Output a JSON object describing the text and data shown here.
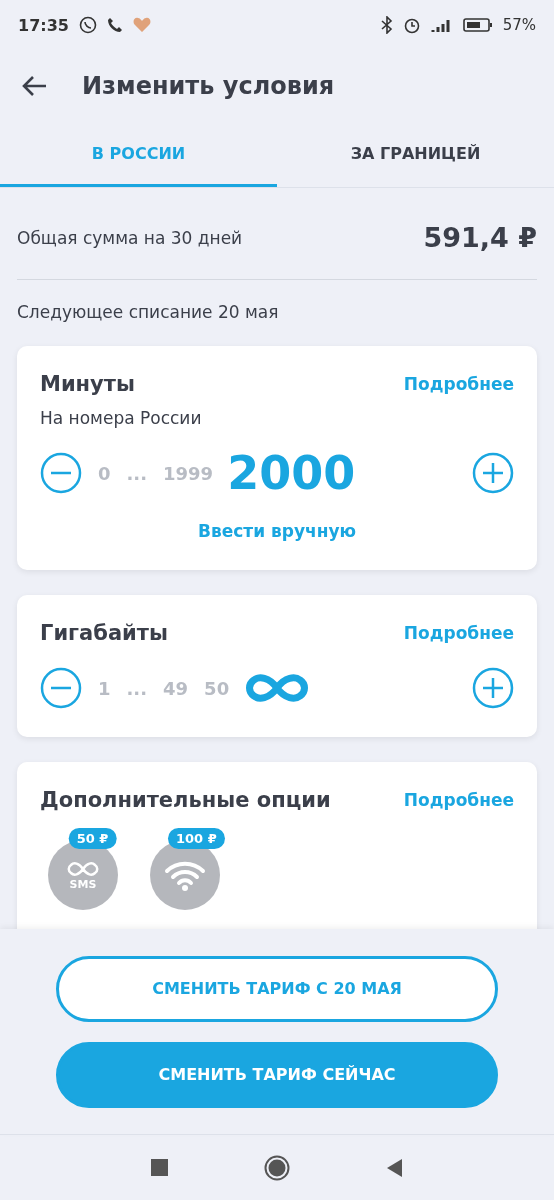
{
  "status_bar": {
    "time": "17:35",
    "battery": "57%"
  },
  "header": {
    "title": "Изменить условия"
  },
  "tabs": [
    {
      "label": "В РОССИИ",
      "selected": true
    },
    {
      "label": "ЗА ГРАНИЦЕЙ",
      "selected": false
    }
  ],
  "summary": {
    "label": "Общая сумма на 30 дней",
    "amount": "591,4 ₽",
    "next_charge": "Следующее списание 20 мая"
  },
  "cards": [
    {
      "title": "Минуты",
      "link": "Подробнее",
      "subtitle": "На номера России",
      "steps": [
        "0",
        "...",
        "1999"
      ],
      "current": {
        "kind": "number",
        "value": "2000"
      },
      "manual": "Ввести вручную"
    },
    {
      "title": "Гигабайты",
      "link": "Подробнее",
      "steps": [
        "1",
        "...",
        "49",
        "50"
      ],
      "current": {
        "kind": "infinity"
      }
    }
  ],
  "options": {
    "title": "Дополнительные опции",
    "link": "Подробнее",
    "items": [
      {
        "kind": "sms",
        "price": "50 ₽",
        "label": "SMS"
      },
      {
        "kind": "wifi",
        "price": "100 ₽"
      }
    ]
  },
  "buttons": [
    {
      "kind": "outline",
      "label": "СМЕНИТЬ ТАРИФ С 20 МАЯ"
    },
    {
      "kind": "filled",
      "label": "СМЕНИТЬ ТАРИФ СЕЙЧАС"
    }
  ]
}
